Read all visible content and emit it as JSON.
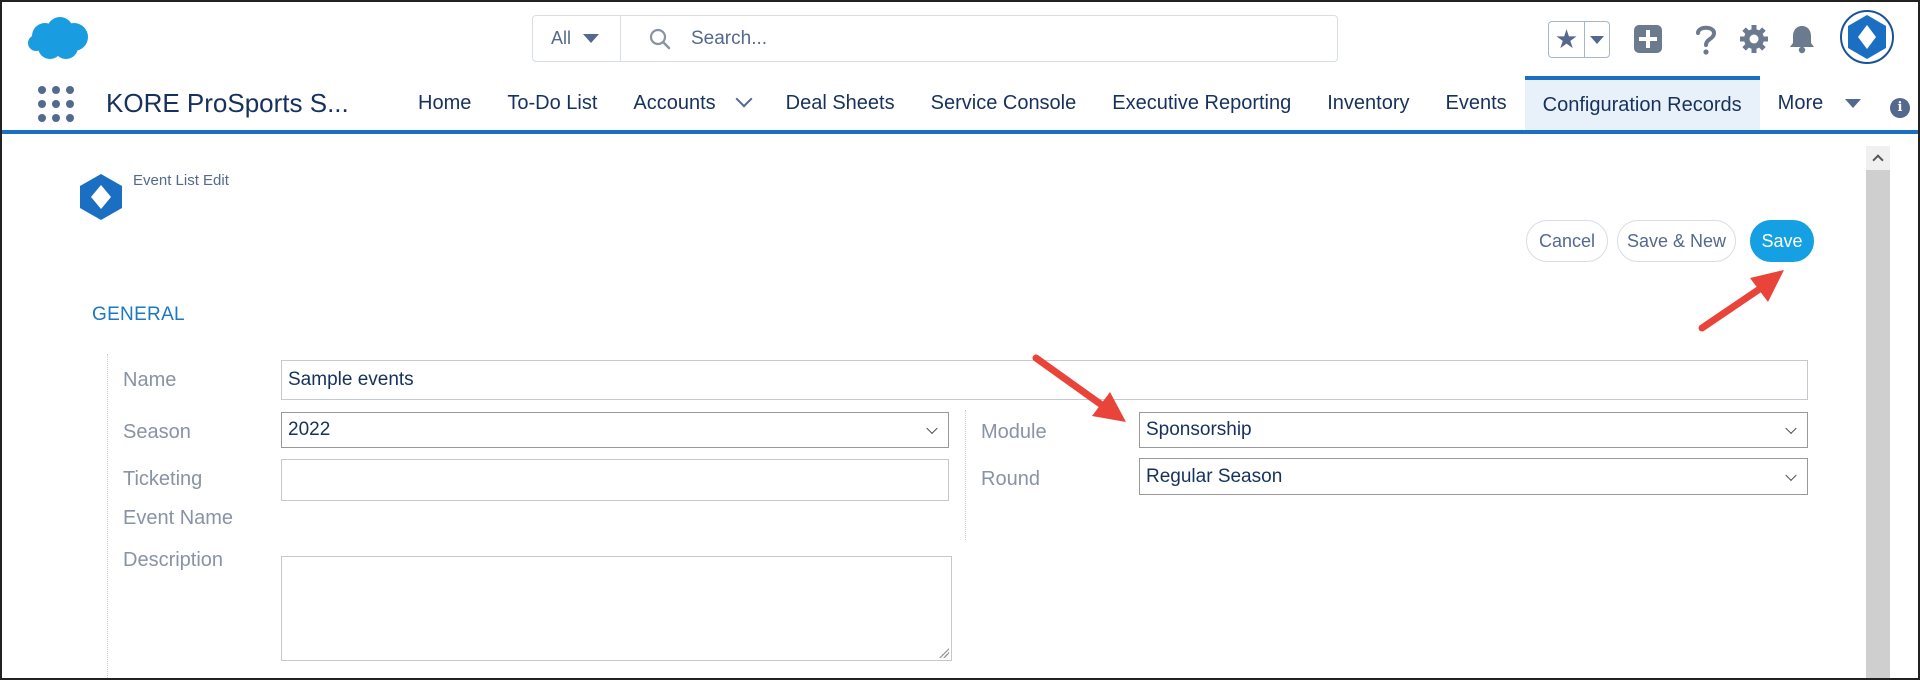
{
  "header": {
    "search": {
      "scope": "All",
      "placeholder": "Search..."
    },
    "icons": [
      "salesforce-cloud-logo",
      "favorites-star-icon",
      "favorites-dropdown-icon",
      "add-icon",
      "help-icon",
      "setup-gear-icon",
      "notifications-bell-icon",
      "user-avatar"
    ]
  },
  "nav": {
    "app_name": "KORE ProSports S...",
    "items": [
      {
        "label": "Home"
      },
      {
        "label": "To-Do List"
      },
      {
        "label": "Accounts"
      },
      {
        "label": "Deal Sheets"
      },
      {
        "label": "Service Console"
      },
      {
        "label": "Executive Reporting"
      },
      {
        "label": "Inventory"
      },
      {
        "label": "Events"
      },
      {
        "label": "Configuration Records"
      },
      {
        "label": "More"
      }
    ],
    "active": "Configuration Records"
  },
  "page": {
    "subtitle": "Event List Edit",
    "buttons": {
      "cancel": "Cancel",
      "save_new": "Save & New",
      "save": "Save"
    },
    "section": "GENERAL"
  },
  "form": {
    "name": {
      "label": "Name",
      "value": "Sample events"
    },
    "season": {
      "label": "Season",
      "value": "2022"
    },
    "ticketing_event_name": {
      "label_line1": "Ticketing",
      "label_line2": "Event Name",
      "value": ""
    },
    "description": {
      "label": "Description",
      "value": ""
    },
    "module": {
      "label": "Module",
      "value": "Sponsorship"
    },
    "round": {
      "label": "Round",
      "value": "Regular Season"
    }
  },
  "colors": {
    "brand_blue": "#1b6fc2",
    "save_button": "#14a0e2",
    "section_title": "#1b78c1",
    "annotation_arrow": "#e8443a"
  }
}
